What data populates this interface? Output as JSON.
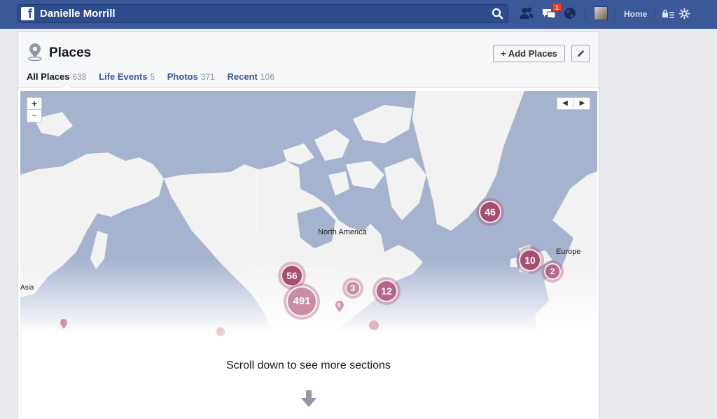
{
  "topbar": {
    "user_name": "Danielle Morrill",
    "notifications_count": "1",
    "home_label": "Home",
    "icons": [
      "friend-requests-icon",
      "messages-icon",
      "notifications-globe-icon",
      "privacy-shortcuts-icon",
      "settings-gear-icon"
    ]
  },
  "places": {
    "title": "Places",
    "add_places_label": "+ Add Places",
    "tabs": [
      {
        "label": "All Places",
        "count": "638"
      },
      {
        "label": "Life Events",
        "count": "5"
      },
      {
        "label": "Photos",
        "count": "371"
      },
      {
        "label": "Recent",
        "count": "106"
      }
    ]
  },
  "map": {
    "zoom_in": "+",
    "zoom_out": "−",
    "prev": "◀",
    "next": "▶",
    "labels": {
      "north_america": "North America",
      "europe": "Europe",
      "asia": "Asia"
    },
    "clusters": {
      "greenland": "46",
      "west_coast": "56",
      "california": "491",
      "midwest": "3",
      "east_coast": "12",
      "uk": "10",
      "central_europe": "2",
      "texas": "5"
    }
  },
  "footer": {
    "scroll_message": "Scroll down to see more sections"
  },
  "colors": {
    "topbar": "#3b5998",
    "cluster": "#a44e70",
    "water": "#a6b3cf",
    "land": "#f2f2f2"
  }
}
